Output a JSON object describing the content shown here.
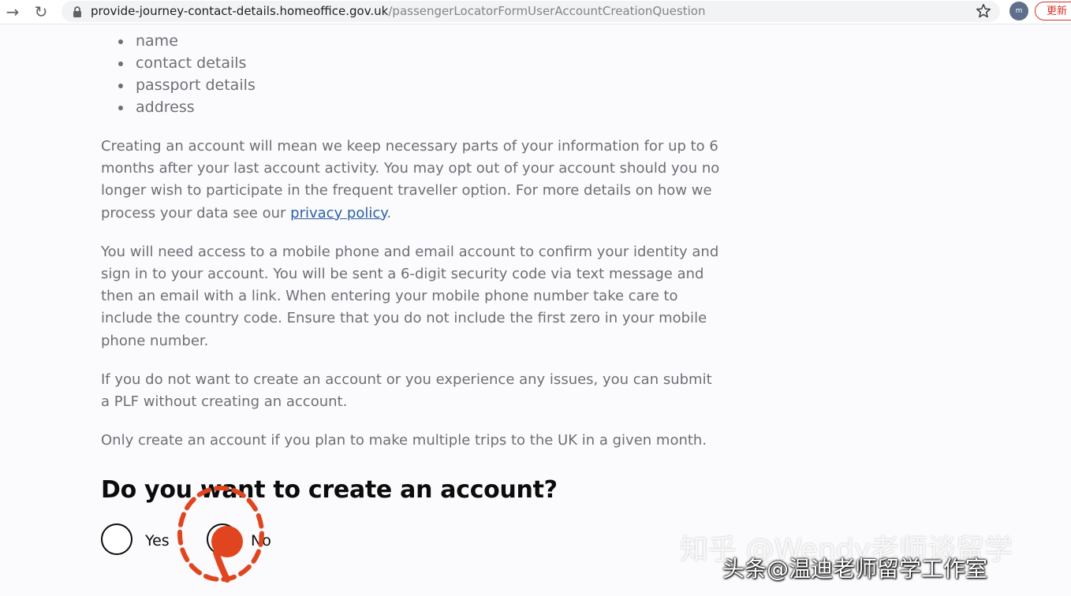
{
  "browser": {
    "url_host": "provide-journey-contact-details.homeoffice.gov.uk",
    "url_path": "/passengerLocatorFormUserAccountCreationQuestion",
    "avatar_text": "m",
    "update_label": "更新"
  },
  "content": {
    "bullets": [
      "name",
      "contact details",
      "passport details",
      "address"
    ],
    "para1_text": "Creating an account will mean we keep necessary parts of your information for up to 6 months after your last account activity. You may opt out of your account should you no longer wish to participate in the frequent traveller option. For more details on how we process your data see our",
    "privacy_link": "privacy policy",
    "para1_end": ".",
    "para2": "You will need access to a mobile phone and email account to confirm your identity and sign in to your account. You will be sent a 6-digit security code via text message and then an email with a link. When entering your mobile phone number take care to include the country code. Ensure that you do not include the first zero in your mobile phone number.",
    "para3": "If you do not want to create an account or you experience any issues, you can submit a PLF without creating an account.",
    "para4": "Only create an account if you plan to make multiple trips to the UK in a given month."
  },
  "question": {
    "heading": "Do you want to create an account?",
    "yes_label": "Yes",
    "no_label": "No",
    "selected": "No"
  },
  "watermark": {
    "large": "知乎 @Wendy老师谈留学",
    "small": "头条@温迪老师留学工作室"
  },
  "colors": {
    "link": "#2c60a8",
    "annotation": "#e0451f",
    "update_chip": "#d93025"
  }
}
